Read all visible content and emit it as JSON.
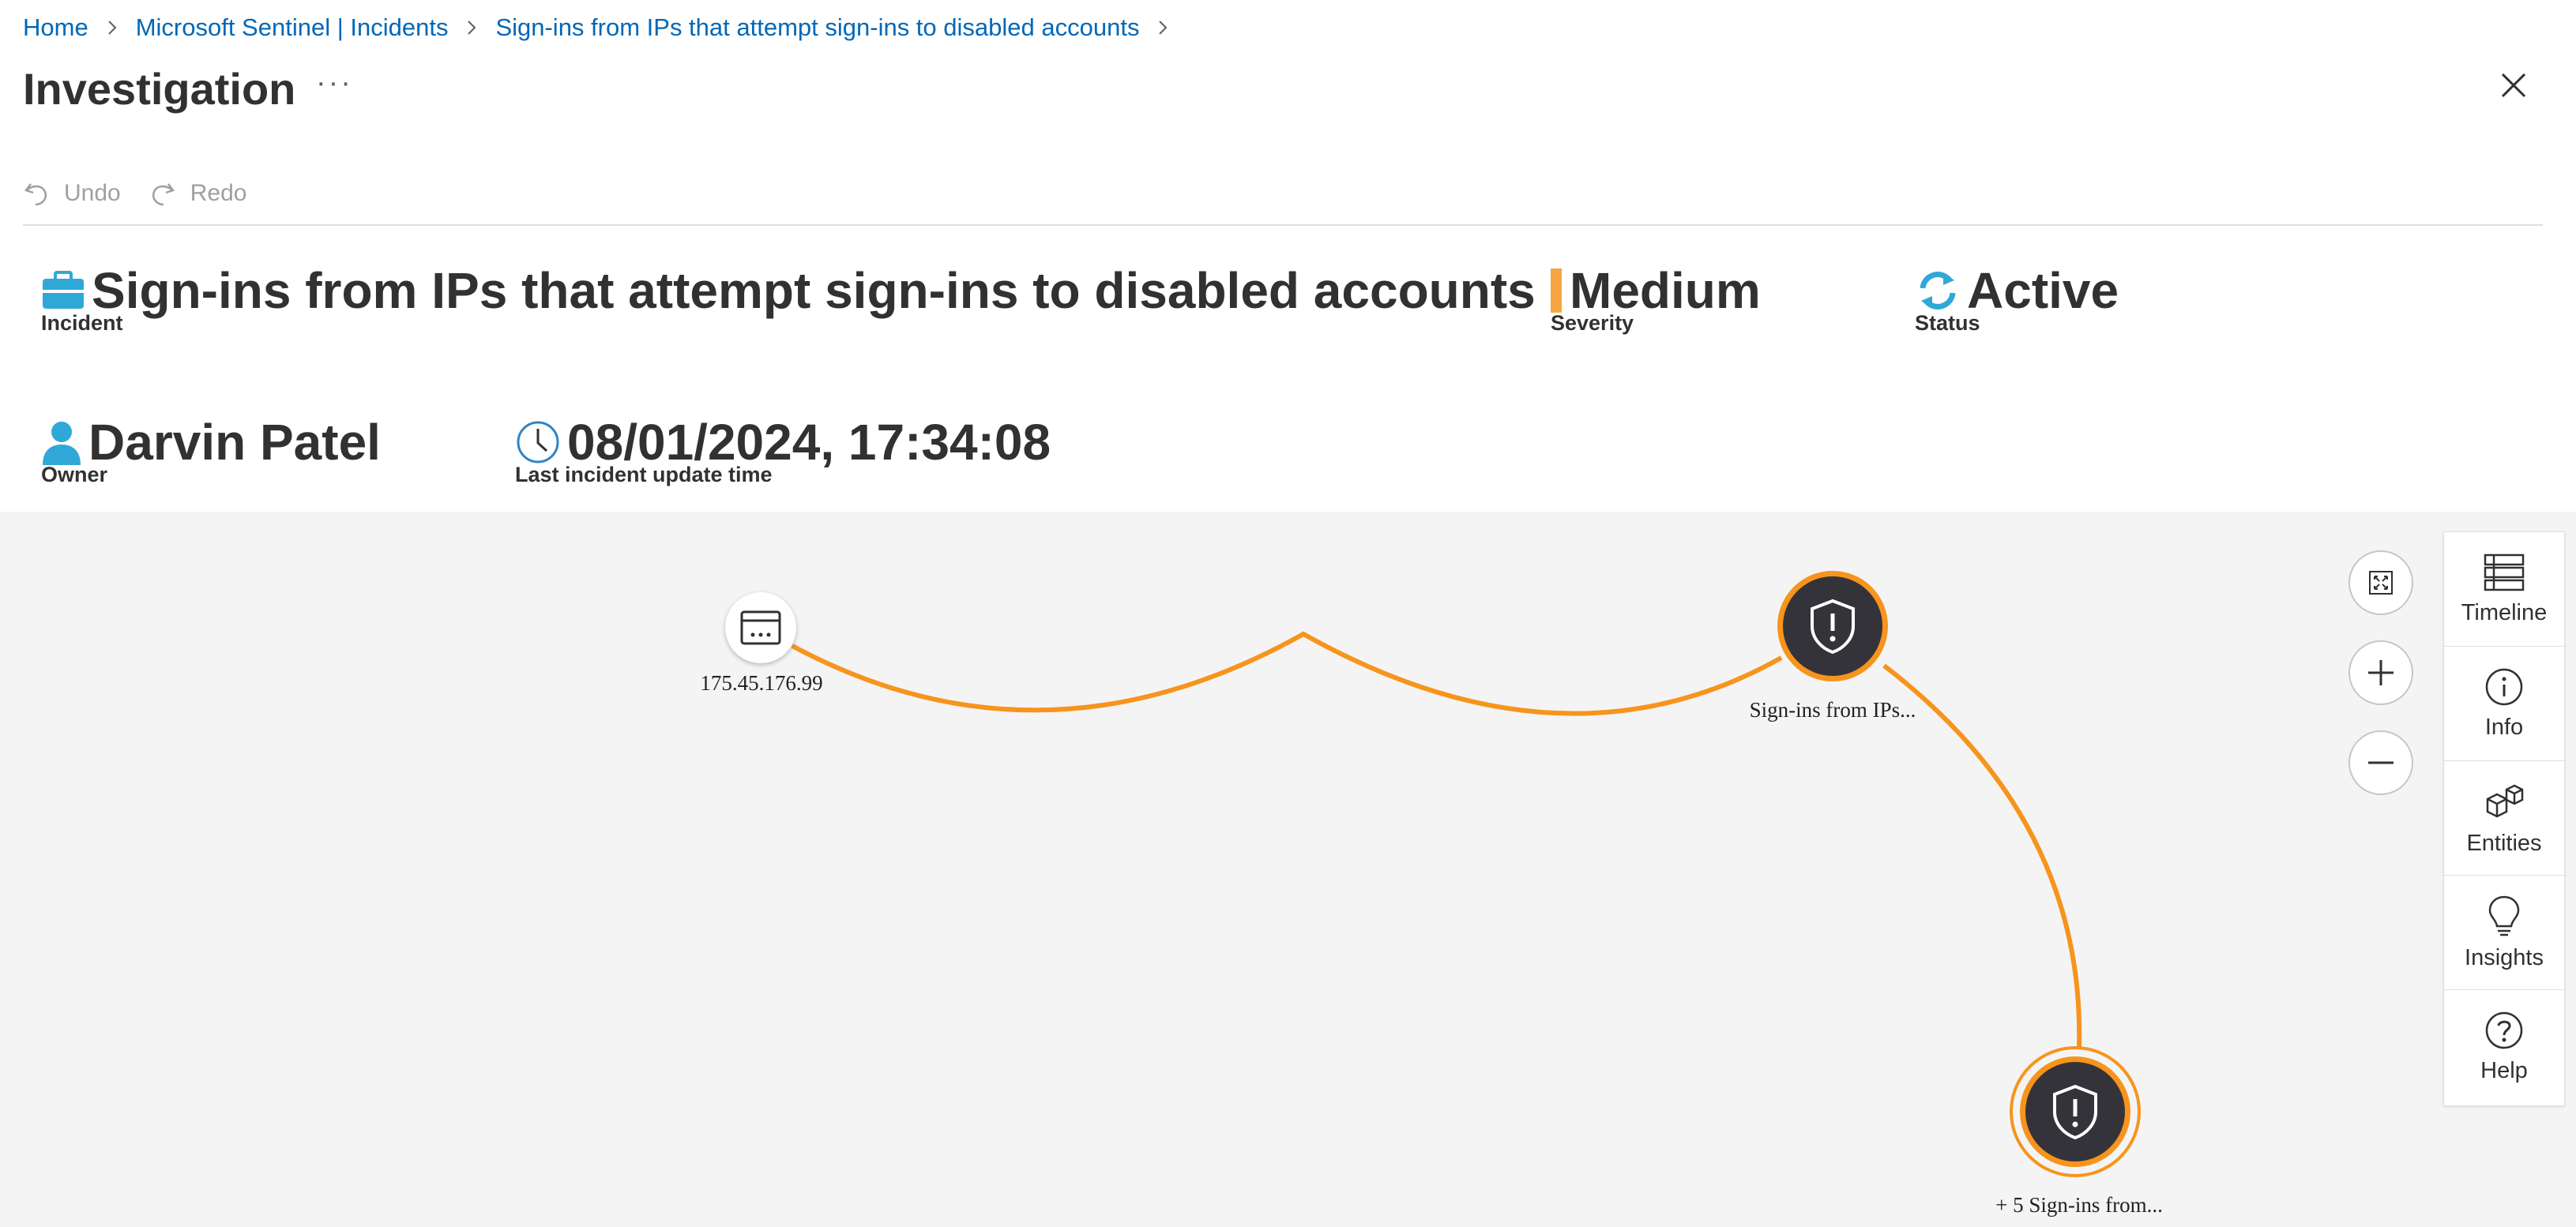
{
  "breadcrumb": {
    "home": "Home",
    "incidents": "Microsoft Sentinel | Incidents",
    "incident": "Sign-ins from IPs that attempt sign-ins to disabled accounts"
  },
  "header": {
    "title": "Investigation",
    "more": "···"
  },
  "toolbar": {
    "undo": "Undo",
    "redo": "Redo"
  },
  "incident": {
    "title": "Sign-ins from IPs that attempt sign-ins to disabled accounts",
    "title_label": "Incident",
    "severity": "Medium",
    "severity_label": "Severity",
    "severity_color": "#f7a541",
    "status": "Active",
    "status_label": "Status",
    "owner": "Darvin Patel",
    "owner_label": "Owner",
    "updated": "08/01/2024, 17:34:08",
    "updated_label": "Last incident update time"
  },
  "graph": {
    "edge_color": "#f7941d",
    "nodes": {
      "ip": "175.45.176.99",
      "alert": "Sign-ins from IPs...",
      "group": "+ 5 Sign-ins from..."
    }
  },
  "side_panel": {
    "timeline": "Timeline",
    "info": "Info",
    "entities": "Entities",
    "insights": "Insights",
    "help": "Help"
  }
}
